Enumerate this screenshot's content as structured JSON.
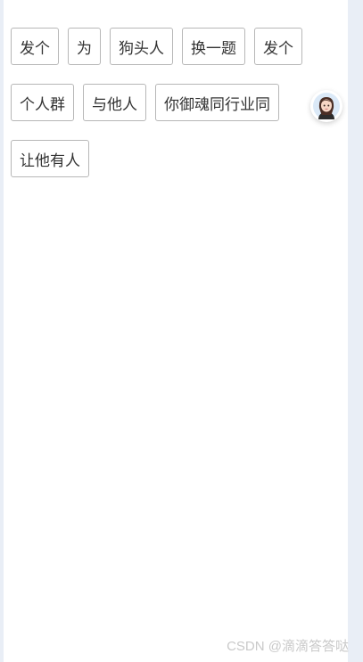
{
  "tags": {
    "row1": [
      "发个",
      "为",
      "狗头人",
      "换一题",
      "发个"
    ],
    "row2": [
      "个人群",
      "与他人",
      "你御魂同行业同"
    ],
    "row3": [
      "让他有人"
    ]
  },
  "floating_avatar": {
    "icon": "avatar-icon"
  },
  "watermark": "CSDN @滴滴答答哒",
  "colors": {
    "background": "#e9eef6",
    "panel": "#ffffff",
    "tag_border": "#b7b7b7",
    "tag_text": "#333333",
    "watermark": "#c9c9c9"
  }
}
